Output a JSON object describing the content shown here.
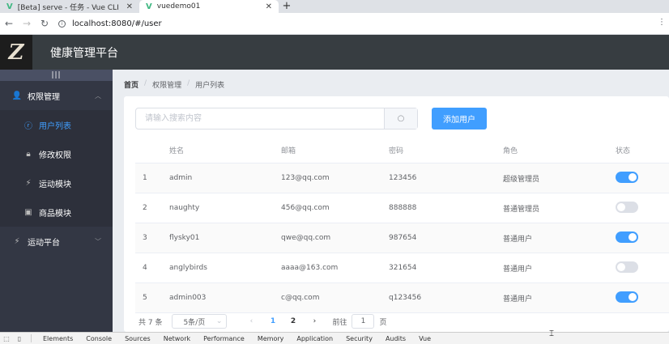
{
  "browser": {
    "tabs": [
      {
        "title": "[Beta] serve - 任务 - Vue CLI",
        "active": false
      },
      {
        "title": "vuedemo01",
        "active": true
      }
    ],
    "url": "localhost:8080/#/user"
  },
  "header": {
    "logo_text": "Z",
    "title": "健康管理平台"
  },
  "sidebar": {
    "toggle": "|||",
    "items": [
      {
        "label": "权限管理",
        "icon": "user-icon",
        "level": "top",
        "arrow": "up"
      },
      {
        "label": "用户列表",
        "icon": "user-icon",
        "level": "sub",
        "active": true
      },
      {
        "label": "修改权限",
        "icon": "lock-icon",
        "level": "sub"
      },
      {
        "label": "运动模块",
        "icon": "run-icon",
        "level": "sub"
      },
      {
        "label": "商品模块",
        "icon": "gift-icon",
        "level": "sub"
      },
      {
        "label": "运动平台",
        "icon": "run-icon",
        "level": "top",
        "arrow": "down"
      }
    ]
  },
  "breadcrumb": [
    "首页",
    "权限管理",
    "用户列表"
  ],
  "search": {
    "placeholder": "请输入搜索内容",
    "value": ""
  },
  "add_button": "添加用户",
  "table": {
    "columns": [
      "",
      "姓名",
      "邮箱",
      "密码",
      "角色",
      "状态"
    ],
    "rows": [
      {
        "index": "1",
        "name": "admin",
        "email": "123@qq.com",
        "password": "123456",
        "role": "超级管理员",
        "status": true
      },
      {
        "index": "2",
        "name": "naughty",
        "email": "456@qq.com",
        "password": "888888",
        "role": "普通管理员",
        "status": false
      },
      {
        "index": "3",
        "name": "flysky01",
        "email": "qwe@qq.com",
        "password": "987654",
        "role": "普通用户",
        "status": true
      },
      {
        "index": "4",
        "name": "anglybirds",
        "email": "aaaa@163.com",
        "password": "321654",
        "role": "普通用户",
        "status": false
      },
      {
        "index": "5",
        "name": "admin003",
        "email": "c@qq.com",
        "password": "q123456",
        "role": "普通用户",
        "status": true
      }
    ]
  },
  "pagination": {
    "total": "共 7 条",
    "page_size": "5条/页",
    "pages": [
      "1",
      "2"
    ],
    "current": "1",
    "goto_label": "前往",
    "goto_value": "1",
    "goto_suffix": "页"
  },
  "devtools": {
    "tabs": [
      "Elements",
      "Console",
      "Sources",
      "Network",
      "Performance",
      "Memory",
      "Application",
      "Security",
      "Audits",
      "Vue"
    ],
    "active": "Console"
  },
  "colors": {
    "primary": "#409eff",
    "sidebar": "#333744",
    "header": "#373d41",
    "background": "#eaedf1"
  }
}
